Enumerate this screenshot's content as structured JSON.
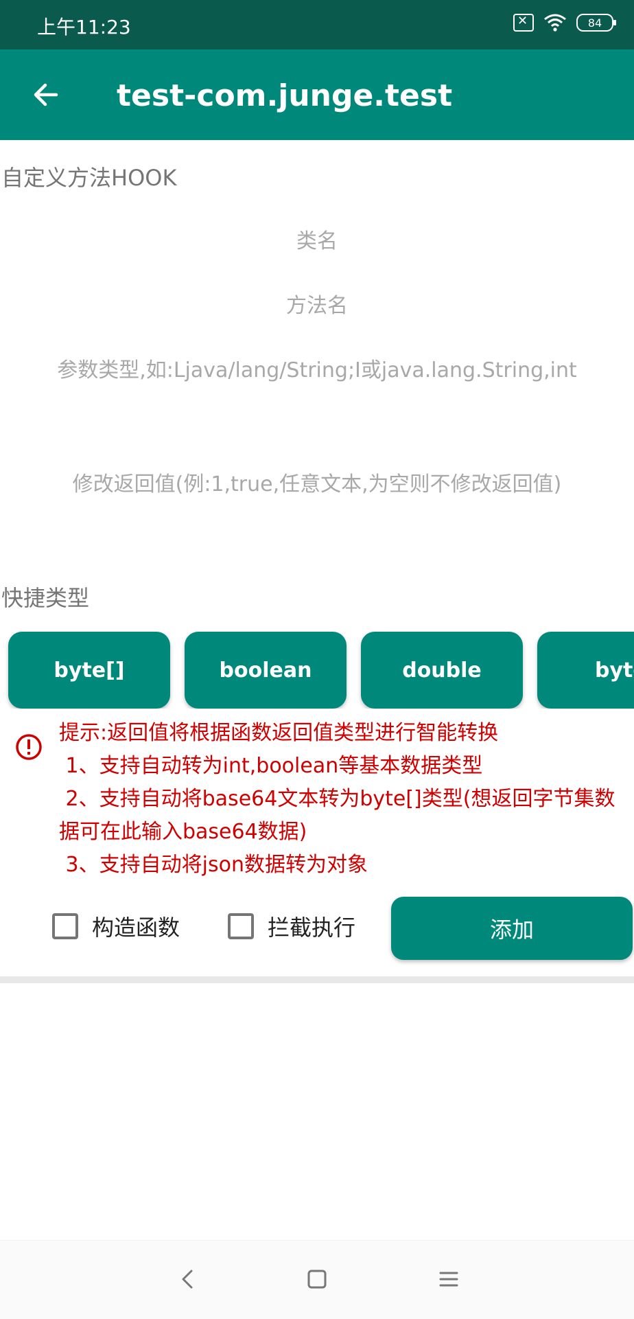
{
  "status_bar": {
    "time": "上午11:23",
    "battery": "84"
  },
  "app_bar": {
    "title": "test-com.junge.test"
  },
  "custom_hook": {
    "section_title": "自定义方法HOOK",
    "class_name_placeholder": "类名",
    "method_name_placeholder": "方法名",
    "param_types_placeholder": "参数类型,如:Ljava/lang/String;I或java.lang.String,int",
    "return_value_placeholder": "修改返回值(例:1,true,任意文本,为空则不修改返回值)"
  },
  "quick_types": {
    "section_title": "快捷类型",
    "chips": [
      "byte[]",
      "boolean",
      "double",
      "byte"
    ]
  },
  "hint": {
    "line1": "提示:返回值将根据函数返回值类型进行智能转换",
    "line2": " 1、支持自动转为int,boolean等基本数据类型",
    "line3": " 2、支持自动将base64文本转为byte[]类型(想返回字节集数据可在此输入base64数据)",
    "line4": " 3、支持自动将json数据转为对象"
  },
  "options": {
    "constructor_label": "构造函数",
    "intercept_label": "拦截执行",
    "add_label": "添加"
  },
  "colors": {
    "accent": "#00897b",
    "status_bar": "#0a5a4e",
    "hint": "#d10000"
  }
}
